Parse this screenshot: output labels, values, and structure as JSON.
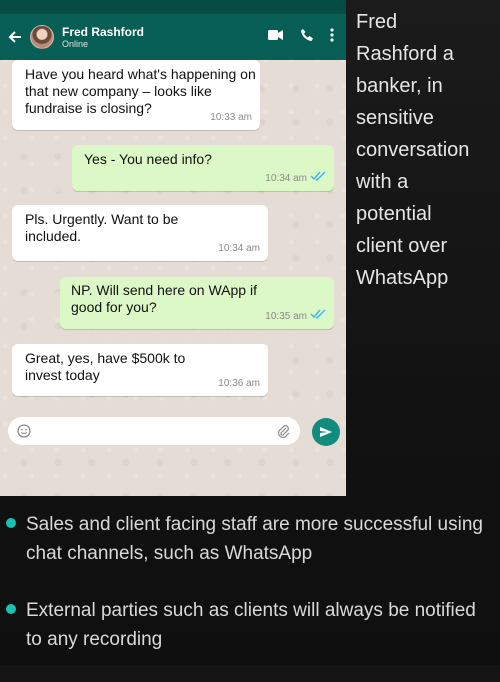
{
  "chat": {
    "contact_name": "Fred Rashford",
    "contact_status": "Online",
    "messages": [
      {
        "dir": "in",
        "text": "Have you heard what's happening on that new company – looks like fundraise is closing?",
        "time": "10:33 am"
      },
      {
        "dir": "out",
        "text": "Yes - You need info?",
        "time": "10:34 am"
      },
      {
        "dir": "in",
        "text": "Pls. Urgently. Want to be included.",
        "time": "10:34 am"
      },
      {
        "dir": "out",
        "text": "NP. Will send here on WApp if good for you?",
        "time": "10:35 am"
      },
      {
        "dir": "in",
        "text": "Great,  yes, have $500k to invest today",
        "time": "10:36 am"
      }
    ],
    "icons": [
      "back-arrow-icon",
      "video-call-icon",
      "phone-icon",
      "more-vert-icon",
      "emoji-icon",
      "attach-icon",
      "send-icon",
      "double-check-icon"
    ]
  },
  "caption": "Fred\nRashford a\nbanker, in\nsensitive\nconversation\nwith a\npotential\nclient over\nWhatsApp",
  "bullets": [
    "Sales and client facing staff are more successful using chat channels, such as WhatsApp",
    "External parties such as clients will always be notified to any recording"
  ],
  "colors": {
    "header": "#075e54",
    "outgoing_bubble": "#dcf8c6",
    "incoming_bubble": "#ffffff",
    "send_button": "#128c7e",
    "bullet": "#19c2b0",
    "read_ticks": "#34b7f1"
  }
}
